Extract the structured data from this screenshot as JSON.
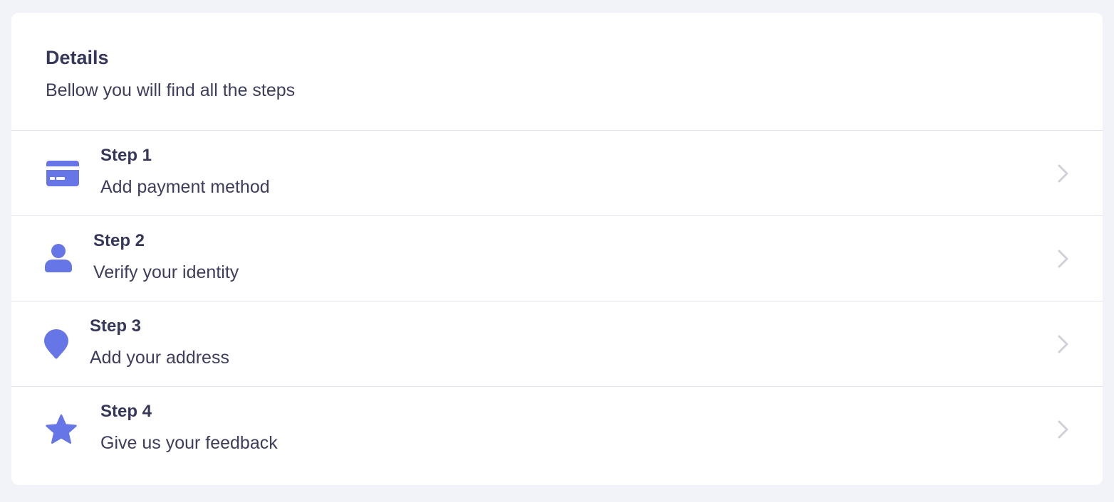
{
  "card": {
    "title": "Details",
    "subtitle": "Bellow you will find all the steps"
  },
  "colors": {
    "accent": "#6676e6",
    "chevron": "#d0d1d8",
    "background": "#f2f3f8",
    "divider": "#e4e5ec"
  },
  "steps": [
    {
      "title": "Step 1",
      "description": "Add payment method",
      "icon": "credit-card-icon"
    },
    {
      "title": "Step 2",
      "description": "Verify your identity",
      "icon": "user-icon"
    },
    {
      "title": "Step 3",
      "description": "Add your address",
      "icon": "map-pin-icon"
    },
    {
      "title": "Step 4",
      "description": "Give us your feedback",
      "icon": "star-icon"
    }
  ]
}
